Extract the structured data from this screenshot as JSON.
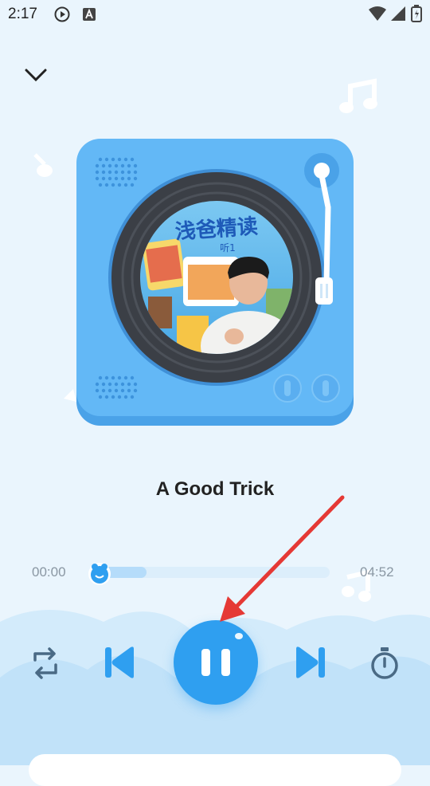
{
  "status_bar": {
    "time": "2:17"
  },
  "player": {
    "album_title_cn": "浅爸精读",
    "album_subtitle_cn": "听1",
    "track_title": "A Good Trick",
    "current_time": "00:00",
    "total_time": "04:52",
    "progress": 0.0
  },
  "controls": {
    "repeat": "repeat-icon",
    "previous": "skip-previous-icon",
    "play_pause": "pause-icon",
    "next": "skip-next-icon",
    "timer": "timer-icon"
  },
  "colors": {
    "background": "#eaf5fd",
    "accent": "#2f9ff0",
    "turntable_body": "#5fb6f4",
    "annotation_arrow": "#e53935"
  }
}
